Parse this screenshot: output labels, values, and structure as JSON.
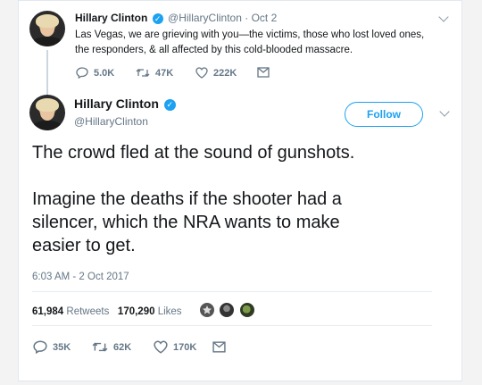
{
  "quoted_tweet": {
    "name": "Hillary Clinton",
    "handle": "@HillaryClinton",
    "date_sep": "·",
    "date": "Oct 2",
    "text_line1": "Las Vegas, we are grieving with you—the victims, those who lost loved ones,",
    "text_line2": "the responders, & all affected by this cold-blooded massacre.",
    "replies": "5.0K",
    "retweets": "47K",
    "likes": "222K"
  },
  "tweet": {
    "name": "Hillary Clinton",
    "handle": "@HillaryClinton",
    "follow_label": "Follow",
    "text_p1": "The crowd fled at the sound of gunshots.",
    "text_p2_line1": "Imagine the deaths if the shooter had a",
    "text_p2_line2": "silencer, which the NRA wants to make",
    "text_p2_line3": "easier to get.",
    "timestamp": "6:03 AM - 2 Oct 2017",
    "retweet_count": "61,984",
    "retweet_label": "Retweets",
    "like_count": "170,290",
    "like_label": "Likes",
    "replies": "35K",
    "retweets": "62K",
    "likes": "170K"
  },
  "colors": {
    "accent": "#1da1f2",
    "muted": "#657786",
    "text": "#14171a"
  }
}
